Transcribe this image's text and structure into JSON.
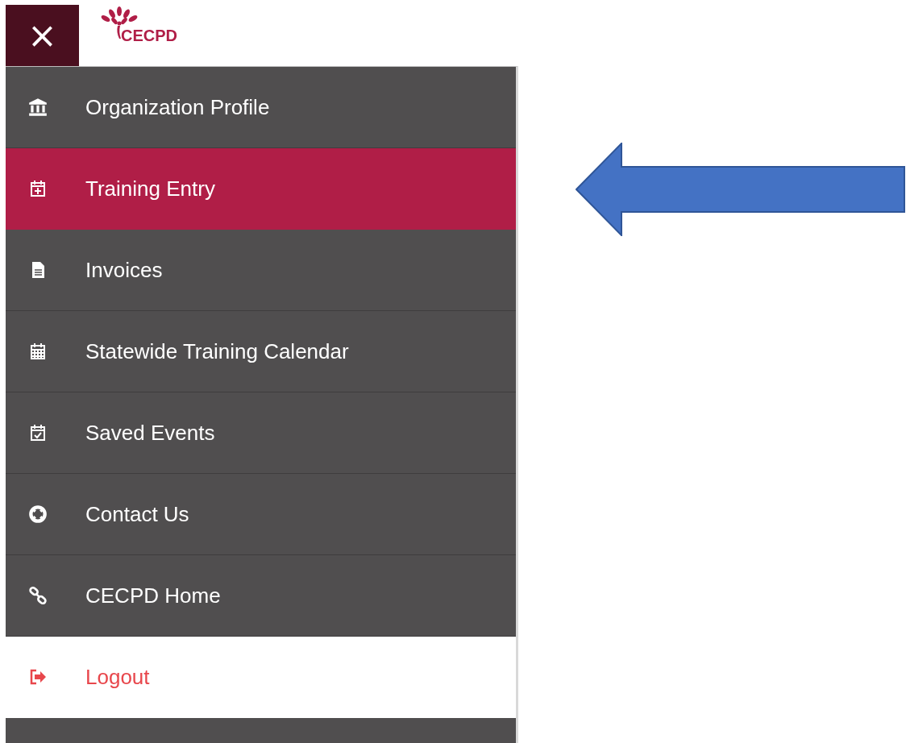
{
  "header": {
    "close_button": "×",
    "logo": "CECPD"
  },
  "menu": {
    "items": [
      {
        "label": "Organization Profile",
        "kind": "link",
        "selected": false
      },
      {
        "label": "Training Entry",
        "kind": "link",
        "selected": true
      },
      {
        "label": "Invoices",
        "kind": "link",
        "selected": false
      },
      {
        "label": "Statewide Training Calendar",
        "kind": "link",
        "selected": false
      },
      {
        "label": "Saved Events",
        "kind": "link",
        "selected": false
      },
      {
        "label": "Contact Us",
        "kind": "link",
        "selected": false
      },
      {
        "label": "CECPD Home",
        "kind": "link",
        "selected": false
      },
      {
        "label": "Logout",
        "kind": "logout",
        "selected": false
      }
    ]
  }
}
